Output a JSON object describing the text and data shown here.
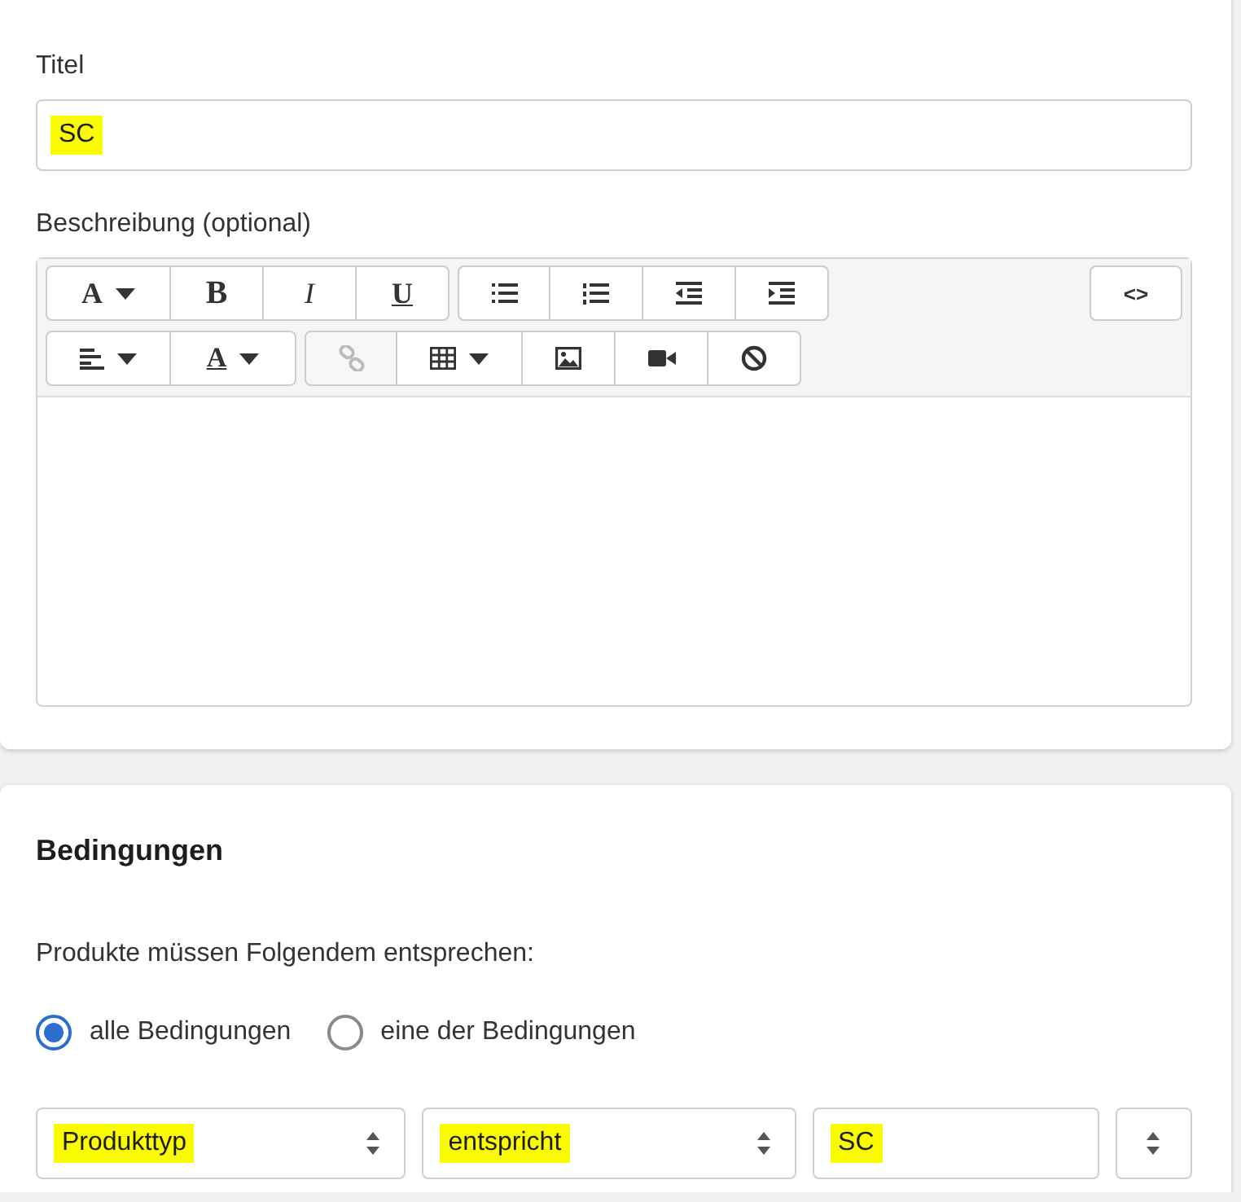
{
  "form": {
    "title_label": "Titel",
    "title_value": "SC",
    "title_highlighted": true,
    "description_label": "Beschreibung (optional)"
  },
  "toolbar": {
    "rows": [
      {
        "left": [
          {
            "buttons": [
              {
                "kind": "font",
                "label": "A",
                "dropdown": true,
                "disabled": false
              },
              {
                "kind": "bold",
                "label": "B",
                "dropdown": false,
                "disabled": false
              },
              {
                "kind": "italic",
                "label": "I",
                "dropdown": false,
                "disabled": false
              },
              {
                "kind": "underline",
                "label": "U",
                "dropdown": false,
                "disabled": false
              }
            ]
          },
          {
            "buttons": [
              {
                "kind": "bullets",
                "dropdown": false,
                "disabled": false
              },
              {
                "kind": "numbers",
                "dropdown": false,
                "disabled": false
              },
              {
                "kind": "outdent",
                "dropdown": false,
                "disabled": false
              },
              {
                "kind": "indent",
                "dropdown": false,
                "disabled": false
              }
            ]
          }
        ],
        "right": [
          {
            "buttons": [
              {
                "kind": "code",
                "label": "<>",
                "dropdown": false,
                "disabled": false
              }
            ]
          }
        ]
      },
      {
        "left": [
          {
            "buttons": [
              {
                "kind": "align",
                "dropdown": true,
                "disabled": false
              },
              {
                "kind": "color",
                "label": "A",
                "dropdown": true,
                "disabled": false
              }
            ]
          },
          {
            "buttons": [
              {
                "kind": "link",
                "dropdown": false,
                "disabled": true
              },
              {
                "kind": "table",
                "dropdown": true,
                "disabled": false
              },
              {
                "kind": "image",
                "dropdown": false,
                "disabled": false
              },
              {
                "kind": "video",
                "dropdown": false,
                "disabled": false
              },
              {
                "kind": "clear",
                "dropdown": false,
                "disabled": false
              }
            ]
          }
        ]
      }
    ]
  },
  "conditions": {
    "heading": "Bedingungen",
    "match_label": "Produkte müssen Folgendem entsprechen:",
    "options": [
      {
        "label": "alle Bedingungen",
        "selected": true
      },
      {
        "label": "eine der Bedingungen",
        "selected": false
      }
    ],
    "rule": {
      "field": "Produkttyp",
      "operator": "entspricht",
      "value": "SC",
      "highlighted": true
    }
  }
}
